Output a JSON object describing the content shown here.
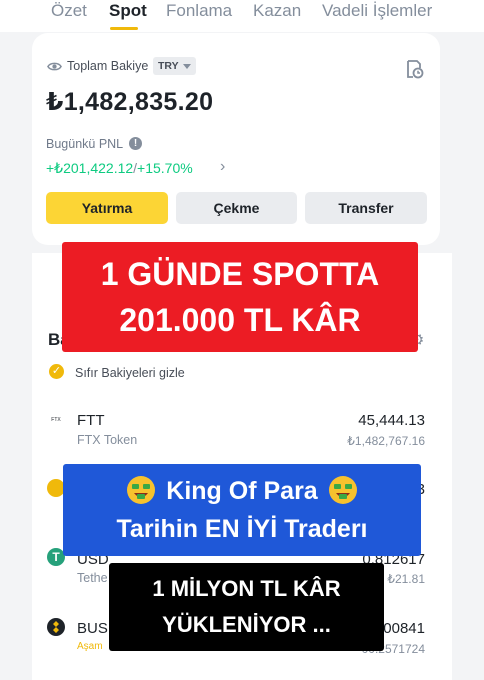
{
  "tabs": [
    {
      "label": "Özet"
    },
    {
      "label": "Spot"
    },
    {
      "label": "Fonlama"
    },
    {
      "label": "Kazan"
    },
    {
      "label": "Vadeli İşlemler"
    }
  ],
  "balance_card": {
    "total_label": "Toplam Bakiye",
    "currency": "TRY",
    "balance": "₺1,482,835.20",
    "pnl_label": "Bugünkü PNL",
    "pnl_amount": "+₺201,422.12",
    "pnl_separator": "/",
    "pnl_percent": "+15.70%"
  },
  "actions": {
    "deposit": "Yatırma",
    "withdraw": "Çekme",
    "transfer": "Transfer"
  },
  "list": {
    "section_head": "Ba",
    "hide_zero_label": "Sıfır Bakiyeleri gizle",
    "assets": [
      {
        "symbol": "FTT",
        "name": "FTX Token",
        "logo_text": "FTX",
        "amount": "45,444.13",
        "value": "₺1,482,767.16"
      },
      {
        "symbol": "",
        "name": "",
        "amount": "3",
        "value": ""
      },
      {
        "symbol": "USD",
        "name": "Tethe",
        "amount": "0.812617",
        "value": "₺21.81"
      },
      {
        "symbol": "BUS",
        "name": "Aşam",
        "amount": "00841",
        "value": "00.2571724"
      }
    ]
  },
  "overlays": {
    "red_line1": "1 GÜNDE SPOTTA",
    "red_line2": "201.000 TL  KÂR",
    "blue_line1": "King  Of  Para",
    "blue_line2": "Tarihin EN İYİ Traderı",
    "black_line1": "1 MİLYON TL KÂR",
    "black_line2": "YÜKLENİYOR ..."
  },
  "colors": {
    "accent": "#fcd535",
    "positive": "#0ecb81",
    "red_banner": "#ec1c24",
    "blue_banner": "#1f58d8"
  }
}
